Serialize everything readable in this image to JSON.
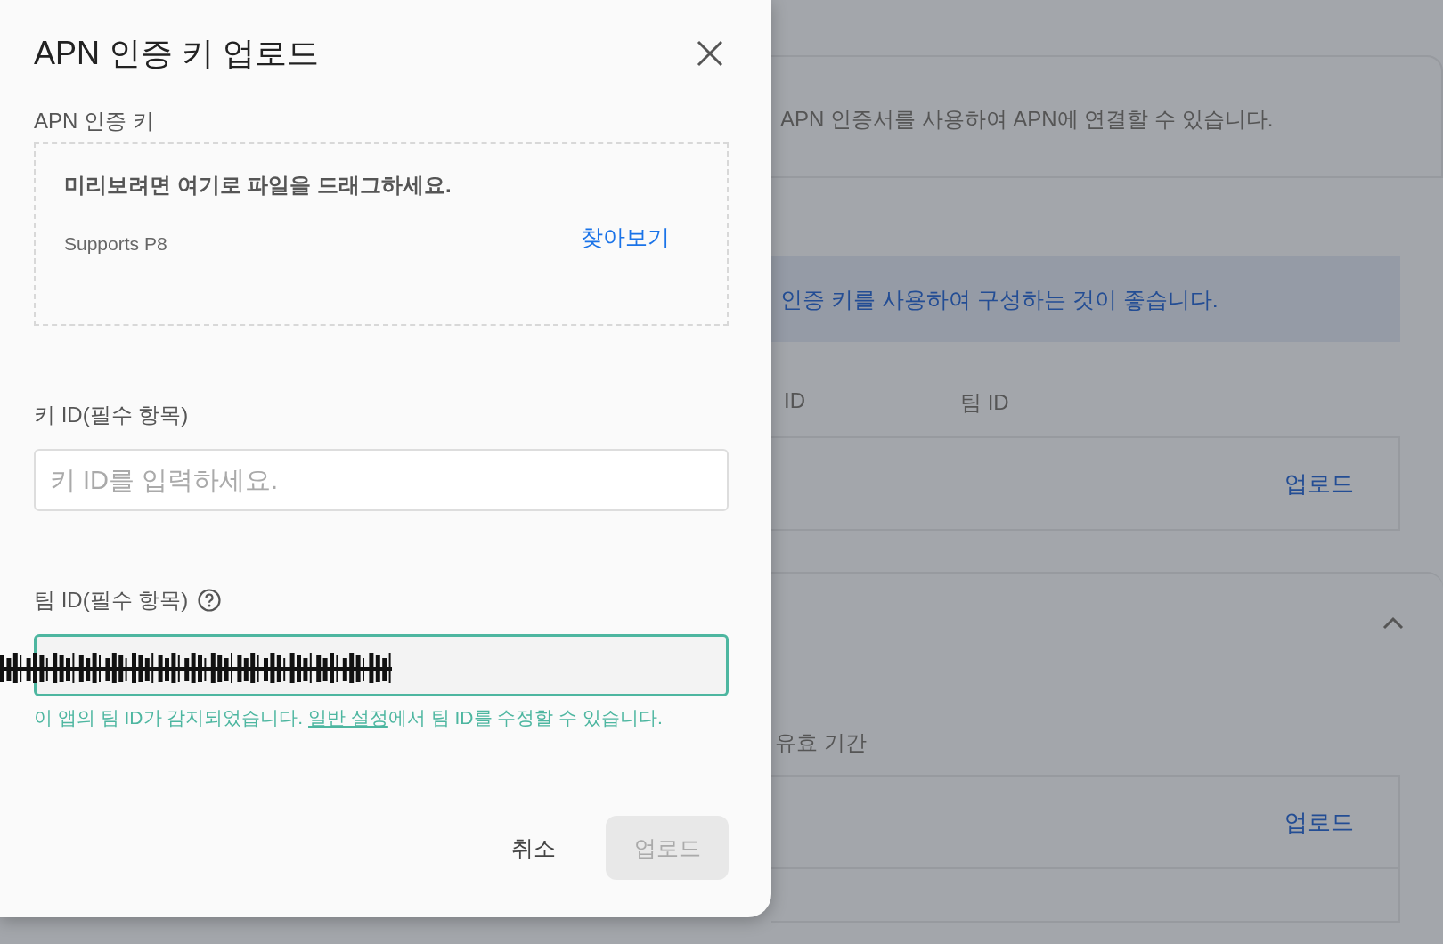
{
  "dialog": {
    "title": "APN 인증 키 업로드",
    "key_file": {
      "label": "APN 인증 키",
      "drop_hint": "미리보려면 여기로 파일을 드래그하세요.",
      "supports": "Supports P8",
      "browse": "찾아보기"
    },
    "key_id": {
      "label": "키 ID(필수 항목)",
      "placeholder": "키 ID를 입력하세요."
    },
    "team_id": {
      "label": "팀 ID(필수 항목)",
      "focused": true,
      "helper_before": "이 앱의 팀 ID가 감지되었습니다. ",
      "helper_link": "일반 설정",
      "helper_after": "에서 팀 ID를 수정할 수 있습니다."
    },
    "buttons": [
      {
        "label": "취소",
        "kind": "text",
        "disabled": false
      },
      {
        "label": "업로드",
        "kind": "filled",
        "disabled": true
      }
    ]
  },
  "background": {
    "intro": "APN 인증서를 사용하여 APN에 연결할 수 있습니다.",
    "notice": "인증 키를 사용하여 구성하는 것이 좋습니다.",
    "key_section": {
      "columns": [
        "ID",
        "팀 ID"
      ],
      "action": "업로드"
    },
    "cert_section": {
      "expanded": true,
      "column": "유효 기간",
      "action": "업로드"
    }
  }
}
